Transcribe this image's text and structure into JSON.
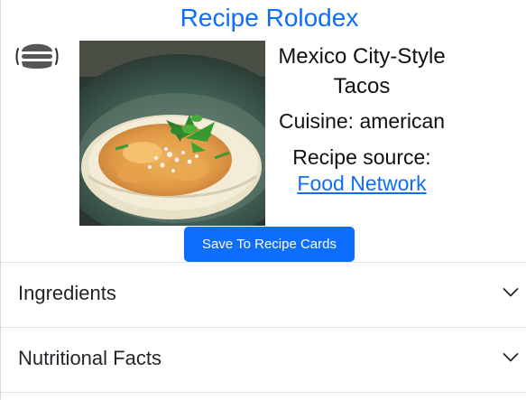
{
  "header": {
    "title": "Recipe Rolodex",
    "menu_icon": "hamburger-burger-icon"
  },
  "recipe": {
    "name": "Mexico City-Style Tacos",
    "cuisine": "Cuisine: american",
    "source_label": "Recipe source:",
    "source_link": "Food Network",
    "image_alt": "taco with scrambled egg, cheese and cilantro"
  },
  "actions": {
    "save_label": "Save To Recipe Cards"
  },
  "accordion": {
    "items": [
      {
        "label": "Ingredients",
        "icon": "chevron-down-icon",
        "expanded": false
      },
      {
        "label": "Nutritional Facts",
        "icon": "chevron-down-icon",
        "expanded": false
      }
    ]
  },
  "colors": {
    "accent": "#0d6efd",
    "text": "#212529",
    "divider": "#dee2e6",
    "button_text": "#ffffff"
  }
}
